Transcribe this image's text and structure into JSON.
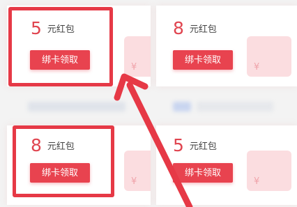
{
  "cards": [
    {
      "amount": "5",
      "unit": "元红包",
      "button": "绑卡领取"
    },
    {
      "amount": "8",
      "unit": "元红包",
      "button": "绑卡领取"
    },
    {
      "amount": "8",
      "unit": "元红包",
      "button": "绑卡领取"
    },
    {
      "amount": "5",
      "unit": "元红包",
      "button": "绑卡领取"
    }
  ],
  "yen_symbol": "¥",
  "colors": {
    "accent": "#e8434f",
    "highlight": "#e63946",
    "arrow": "#e63946"
  }
}
